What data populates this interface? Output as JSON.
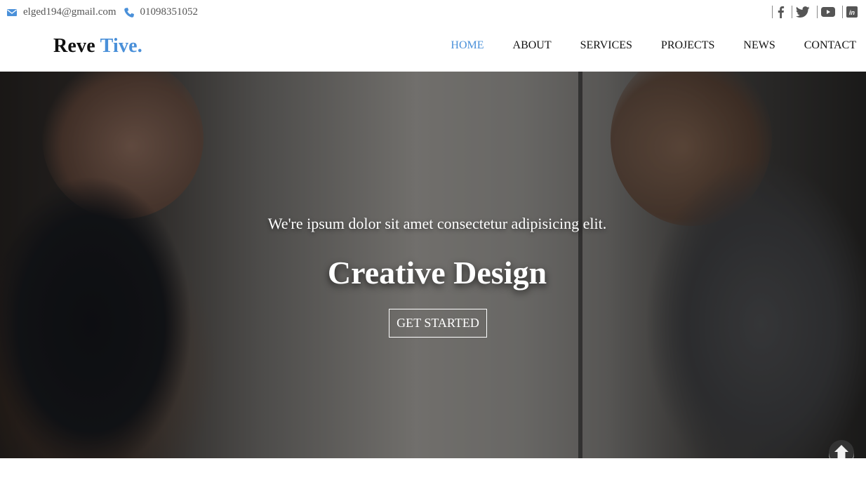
{
  "topbar": {
    "email": "elged194@gmail.com",
    "phone": "01098351052",
    "email_icon": "envelope-icon",
    "phone_icon": "phone-icon",
    "social": [
      "facebook-icon",
      "twitter-icon",
      "youtube-icon",
      "linkedin-icon"
    ]
  },
  "brand": {
    "part1": "Reve",
    "part2": "Tive."
  },
  "nav": {
    "items": [
      "HOME",
      "ABOUT",
      "SERVICES",
      "PROJECTS",
      "NEWS",
      "CONTACT"
    ],
    "active": "HOME"
  },
  "hero": {
    "subtitle": "We're ipsum dolor sit amet consectetur adipisicing elit.",
    "title": "Creative Design",
    "button": "GET STARTED"
  },
  "scroll_top": {
    "icon": "arrow-up-circle-icon"
  },
  "colors": {
    "accent": "#4a90d9",
    "text": "#111111"
  }
}
